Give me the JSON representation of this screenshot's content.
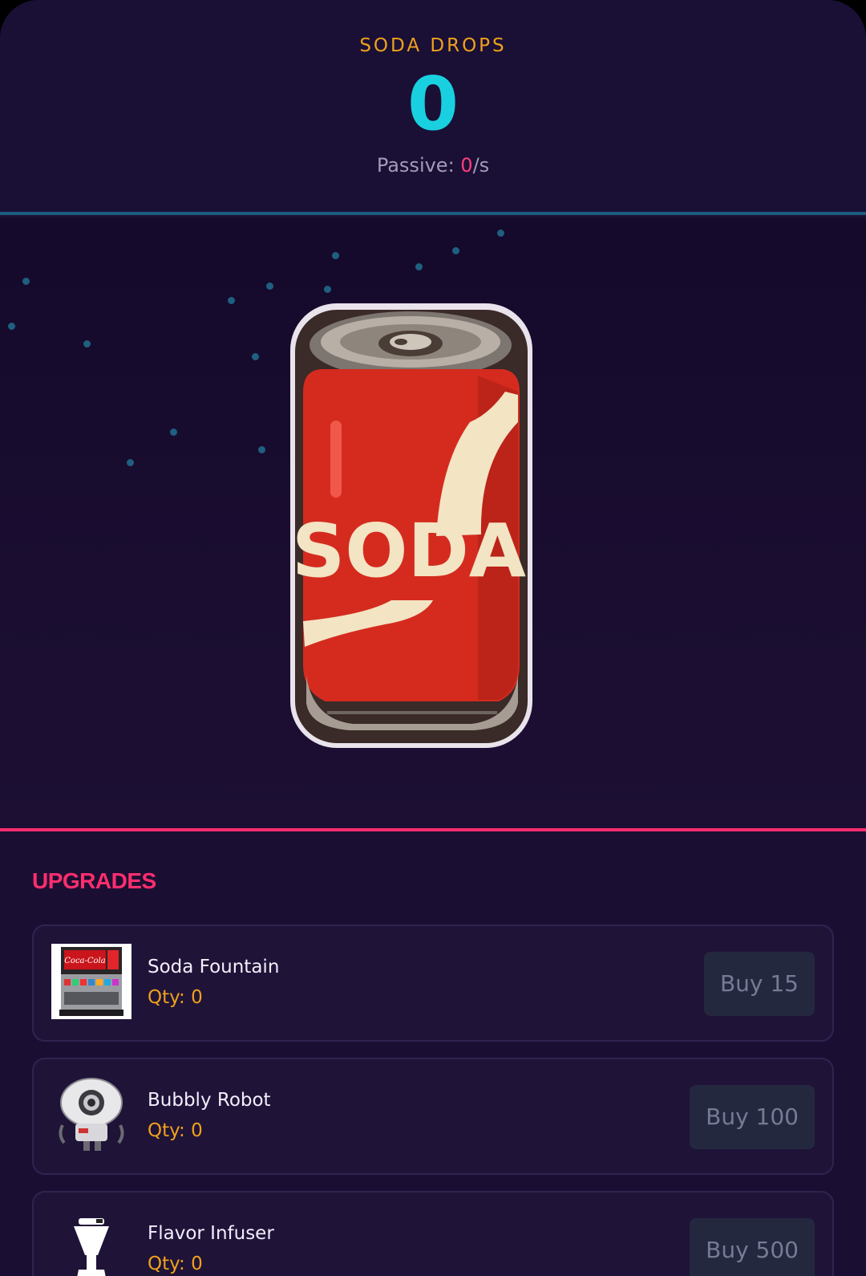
{
  "header": {
    "counter_label": "SODA DROPS",
    "counter_value": "0",
    "passive_prefix": "Passive: ",
    "passive_rate": "0",
    "passive_suffix": "/s"
  },
  "can": {
    "label": "SODA"
  },
  "upgrades": {
    "title": "UPGRADES",
    "items": [
      {
        "name": "Soda Fountain",
        "qty": "Qty: 0",
        "buy": "Buy 15",
        "thumb_label": "Coca-Cola"
      },
      {
        "name": "Bubbly Robot",
        "qty": "Qty: 0",
        "buy": "Buy 100"
      },
      {
        "name": "Flavor Infuser",
        "qty": "Qty: 0",
        "buy": "Buy 500"
      }
    ]
  },
  "colors": {
    "background": "#1a0f33",
    "counter_label": "#f0a11c",
    "counter_value": "#19d0e0",
    "passive_rate": "#ff3d7f",
    "accent_line_top": "#1d5b80",
    "accent_line_bottom": "#ff2d6e",
    "can_red": "#d62a1e",
    "can_cream": "#f3e4c3"
  }
}
